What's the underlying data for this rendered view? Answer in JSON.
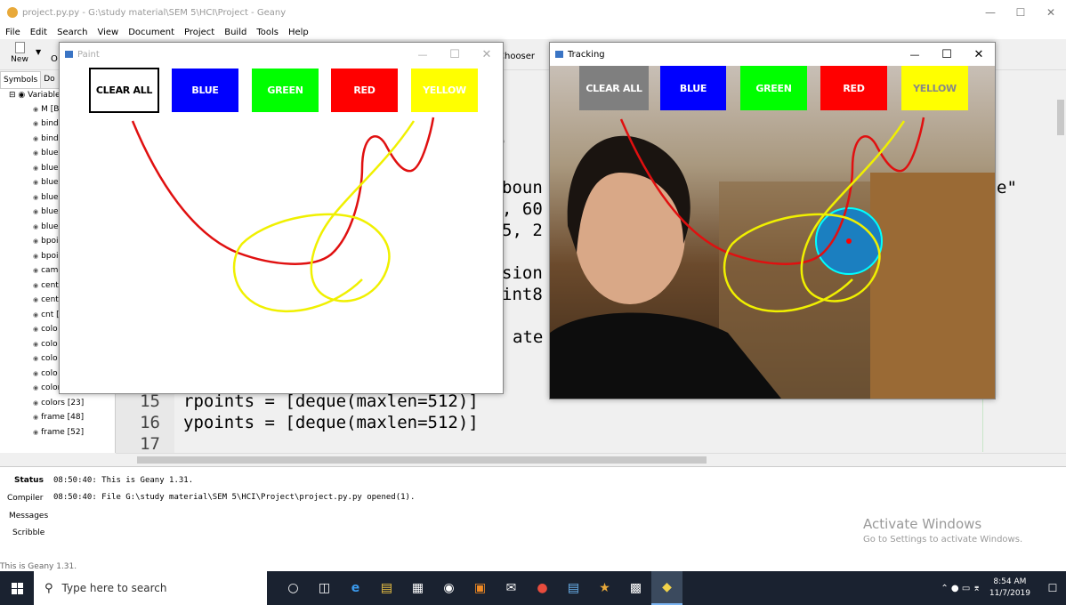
{
  "geany": {
    "title": "project.py.py - G:\\study material\\SEM 5\\HCI\\Project - Geany",
    "menu": [
      "File",
      "Edit",
      "Search",
      "View",
      "Document",
      "Project",
      "Build",
      "Tools",
      "Help"
    ],
    "toolbar": {
      "new_label": "New",
      "open_label": "O",
      "chooser_label": "Chooser"
    },
    "sidebar": {
      "tabs": [
        "Symbols",
        "Do"
      ],
      "root": "Variable",
      "items": [
        "M [B",
        "bind",
        "bind",
        "bluel",
        "bluel",
        "bluel",
        "bluel",
        "bluel",
        "bluel",
        "bpoi",
        "bpoi",
        "came",
        "cent",
        "cent",
        "cnt [",
        "colo",
        "colo",
        "colo",
        "colo",
        "colorIndex [11",
        "colors [23]",
        "frame [48]",
        "frame [52]"
      ]
    },
    "editor": {
      "lines": [
        {
          "num": "15",
          "code": "rpoints = [deque(maxlen=512)]"
        },
        {
          "num": "16",
          "code": "ypoints = [deque(maxlen=512)]"
        },
        {
          "num": "17",
          "code": ""
        }
      ],
      "background_fragments": [
        "e",
        "boun",
        ", 60",
        "5, 2",
        "sion",
        "int8",
        "ate",
        "e\""
      ]
    },
    "messages": {
      "tabs": [
        "Status",
        "Compiler",
        "Messages",
        "Scribble"
      ],
      "lines": [
        "08:50:40: This is Geany 1.31.",
        "08:50:40: File G:\\study material\\SEM 5\\HCI\\Project\\project.py.py opened(1)."
      ]
    },
    "statusbar": "This is Geany 1.31."
  },
  "paint": {
    "title": "Paint",
    "buttons": [
      {
        "label": "CLEAR ALL",
        "color": "#ffffff"
      },
      {
        "label": "BLUE",
        "color": "#0000ff"
      },
      {
        "label": "GREEN",
        "color": "#00ff00"
      },
      {
        "label": "RED",
        "color": "#ff0000"
      },
      {
        "label": "YELLOW",
        "color": "#ffff00"
      }
    ]
  },
  "tracking": {
    "title": "Tracking",
    "buttons": [
      {
        "label": "CLEAR ALL",
        "color": "#7f7f7f"
      },
      {
        "label": "BLUE",
        "color": "#0000ff"
      },
      {
        "label": "GREEN",
        "color": "#00ff00"
      },
      {
        "label": "RED",
        "color": "#ff0000"
      },
      {
        "label": "YELLOW",
        "color": "#ffff00"
      }
    ]
  },
  "watermark": {
    "line1": "Activate Windows",
    "line2": "Go to Settings to activate Windows."
  },
  "taskbar": {
    "search_placeholder": "Type here to search",
    "time": "8:54 AM",
    "date": "11/7/2019",
    "apps": [
      "cortana-icon",
      "task-view-icon",
      "edge-icon",
      "file-explorer-icon",
      "store-icon",
      "camera-icon",
      "photos-icon",
      "mail-icon",
      "chrome-icon",
      "notepad-icon",
      "geany-icon",
      "terminal-icon",
      "python-icon"
    ]
  }
}
